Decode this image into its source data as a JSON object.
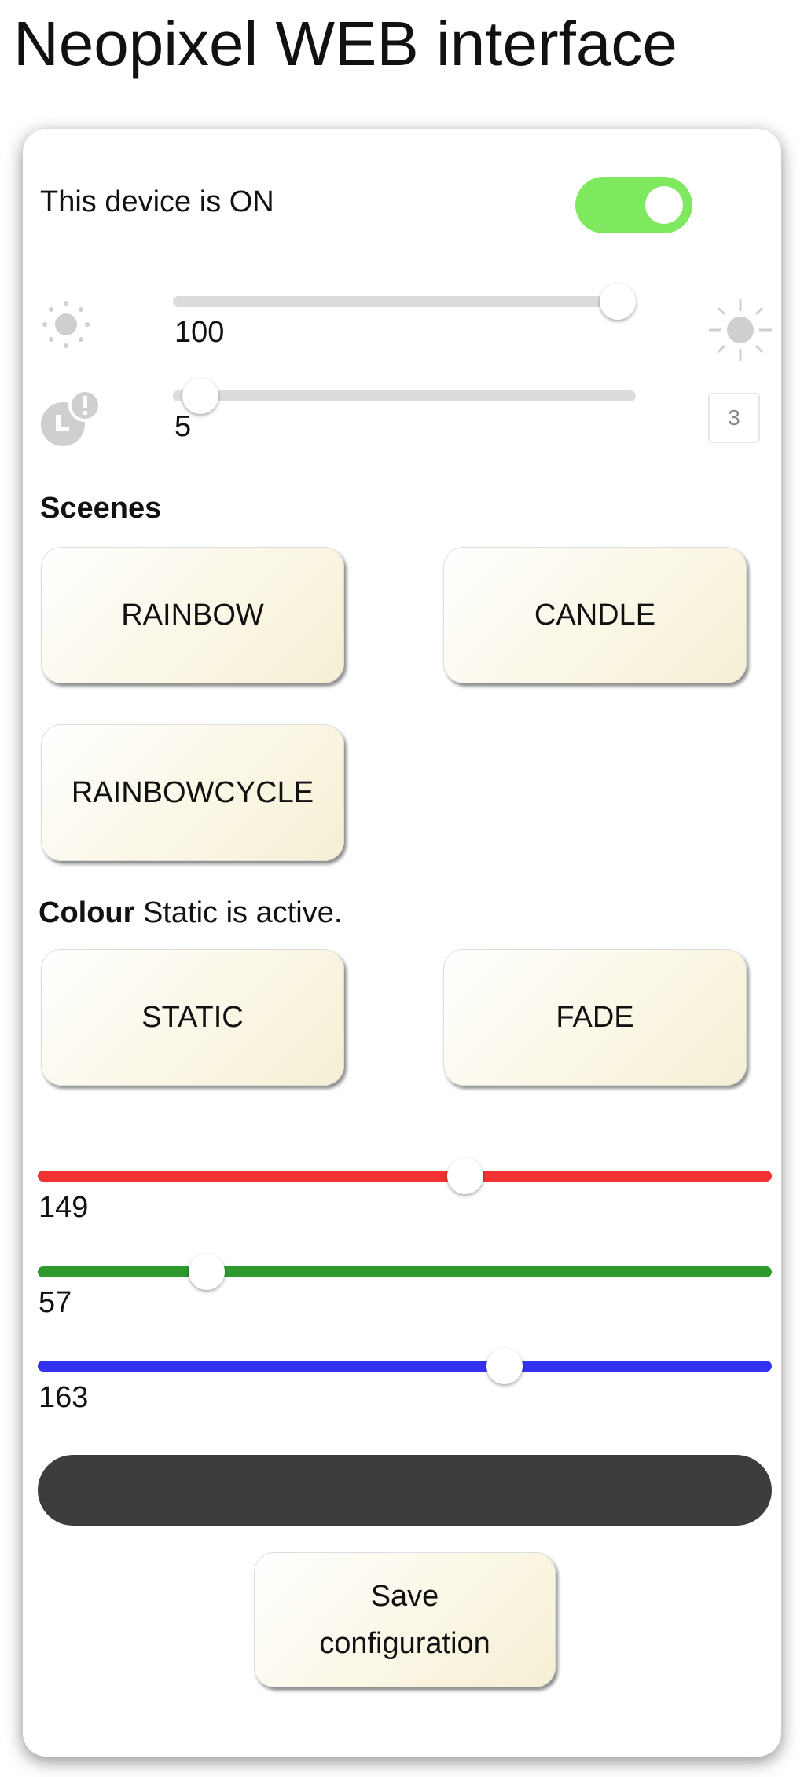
{
  "title": "Neopixel WEB interface",
  "power": {
    "label": "This device is ON",
    "on": true,
    "color": "#7ee85e"
  },
  "brightness": {
    "value": 100,
    "min": 0,
    "max": 102,
    "value_label": "100",
    "icon_low": "sun-dim-icon",
    "icon_high": "sun-bright-icon"
  },
  "timer": {
    "value": 5,
    "min": 1,
    "max": 100,
    "value_label": "5",
    "icon": "clock-alert-icon",
    "box_value": "3"
  },
  "scenes": {
    "heading": "Sceenes",
    "buttons": [
      "RAINBOW",
      "CANDLE",
      "RAINBOWCYCLE"
    ]
  },
  "colour": {
    "heading": "Colour",
    "status": "Static is active.",
    "buttons": [
      "STATIC",
      "FADE"
    ]
  },
  "rgb": {
    "max": 255,
    "red": {
      "value": 149,
      "label": "149",
      "color": "#f23232"
    },
    "green": {
      "value": 57,
      "label": "57",
      "color": "#2e9a2e"
    },
    "blue": {
      "value": 163,
      "label": "163",
      "color": "#3232f0"
    }
  },
  "preview_color": "#3d3d3d",
  "save_button": {
    "line1": "Save",
    "line2": "configuration"
  }
}
